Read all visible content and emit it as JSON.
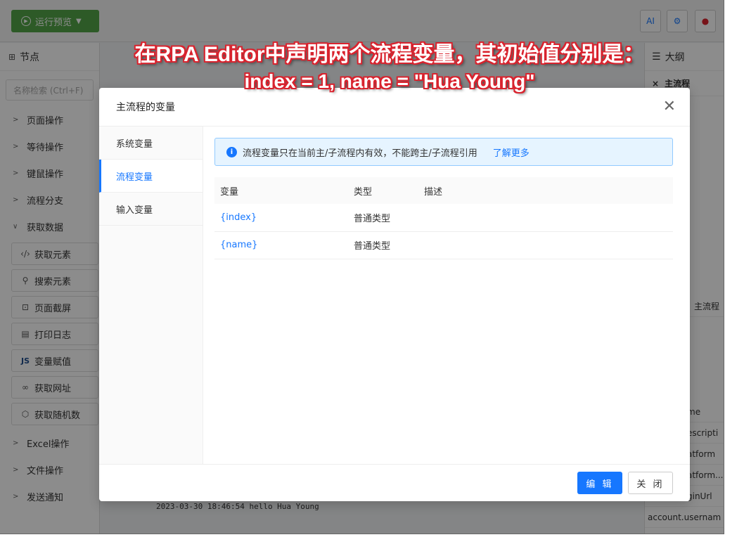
{
  "toolbar": {
    "run_label": "运行预览",
    "ai_label": "AI"
  },
  "left_panel": {
    "title": "节点",
    "search_placeholder": "名称检索 (Ctrl+F)",
    "categories_top": [
      "页面操作",
      "等待操作",
      "键鼠操作",
      "流程分支",
      "获取数据"
    ],
    "sub_items": [
      "获取元素",
      "搜索元素",
      "页面截屏",
      "打印日志",
      "变量赋值",
      "获取网址",
      "获取随机数"
    ],
    "categories_bottom": [
      "Excel操作",
      "文件操作",
      "发送通知"
    ]
  },
  "right_panel": {
    "title": "大纲",
    "tree_root": "主流程",
    "mid_label": "主流程",
    "props": [
      "me",
      "escripti",
      "atform",
      "atform...",
      "ginUrl",
      "account.usernam"
    ]
  },
  "log": {
    "line": "2023-03-30 18:46:54 hello Hua Young"
  },
  "modal": {
    "title": "主流程的变量",
    "tabs": [
      "系统变量",
      "流程变量",
      "输入变量"
    ],
    "notice_text": "流程变量只在当前主/子流程内有效，不能跨主/子流程引用",
    "notice_link": "了解更多",
    "table": {
      "headers": [
        "变量",
        "类型",
        "描述"
      ],
      "rows": [
        {
          "name": "{index}",
          "type": "普通类型",
          "desc": ""
        },
        {
          "name": "{name}",
          "type": "普通类型",
          "desc": ""
        }
      ]
    },
    "edit_label": "编 辑",
    "close_label": "关 闭"
  },
  "annotation": {
    "line1": "在RPA Editor中声明两个流程变量，其初始值分别是：",
    "line2": "index = 1,  name = \"Hua Young\""
  },
  "colors": {
    "primary": "#1677ff",
    "run_green": "#52a447",
    "annotation_red": "#d9232e"
  }
}
